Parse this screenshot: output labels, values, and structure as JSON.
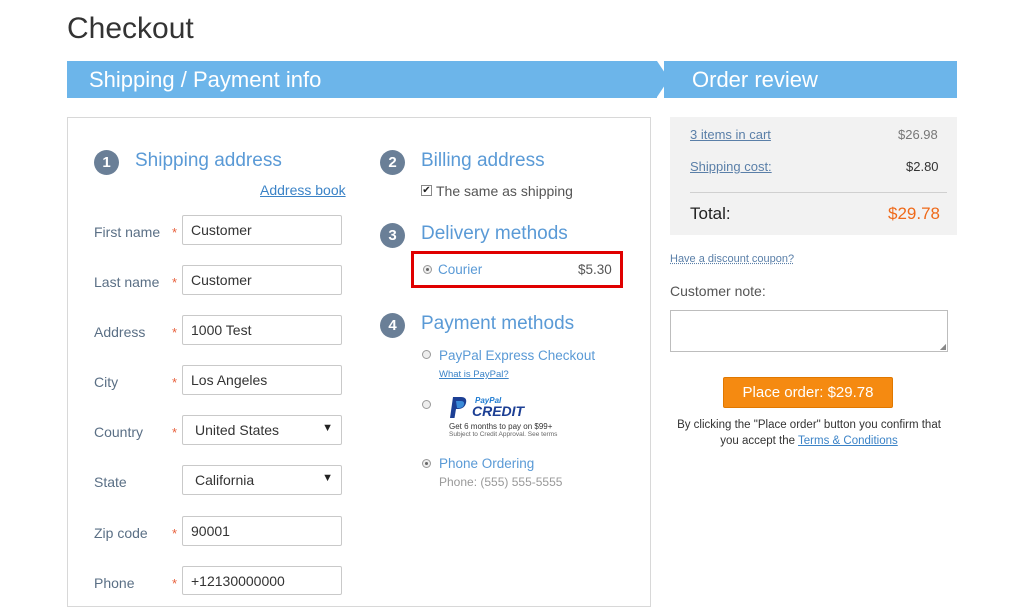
{
  "page": {
    "title": "Checkout"
  },
  "header": {
    "left_label": "Shipping / Payment info",
    "right_label": "Order review"
  },
  "shipping": {
    "step": "1",
    "title": "Shipping address",
    "address_book": "Address book",
    "fields": {
      "first_name": {
        "label": "First name",
        "value": "Customer"
      },
      "last_name": {
        "label": "Last name",
        "value": "Customer"
      },
      "address": {
        "label": "Address",
        "value": "1000 Test"
      },
      "city": {
        "label": "City",
        "value": "Los Angeles"
      },
      "country": {
        "label": "Country",
        "value": "United States"
      },
      "state": {
        "label": "State",
        "value": "California"
      },
      "zip": {
        "label": "Zip code",
        "value": "90001"
      },
      "phone": {
        "label": "Phone",
        "value": "+12130000000"
      }
    },
    "required_mark": "*"
  },
  "billing": {
    "step": "2",
    "title": "Billing address",
    "same_as_shipping": "The same as shipping",
    "checked": true
  },
  "delivery": {
    "step": "3",
    "title": "Delivery methods",
    "method": "Courier",
    "price": "$5.30",
    "highlight_color": "#e00000"
  },
  "payment": {
    "step": "4",
    "title": "Payment methods",
    "paypal_express": "PayPal Express Checkout",
    "what_is_paypal": "What is PayPal?",
    "paypal_credit_logo_top": "PayPal",
    "paypal_credit_logo": "CREDIT",
    "paypal_credit_line1": "Get 6 months to pay on $99+",
    "paypal_credit_line2": "Subject to Credit Approval. See terms",
    "phone_ordering": "Phone Ordering",
    "phone_note": "Phone: (555) 555-5555",
    "selected": "phone_ordering"
  },
  "review": {
    "items_link": "3 items in cart",
    "items_value": "$26.98",
    "shipping_link": "Shipping cost:",
    "shipping_value": "$2.80",
    "total_label": "Total:",
    "total_value": "$29.78"
  },
  "coupon_link": "Have a discount coupon?",
  "customer_note_label": "Customer note:",
  "place_order_label": "Place order: $29.78",
  "terms_text_1": "By clicking the \"Place order\" button you confirm that",
  "terms_text_2": "you accept the ",
  "terms_link": "Terms & Conditions",
  "colors": {
    "accent": "#6cb5ea",
    "button": "#f58a11",
    "total": "#ef6a1a",
    "link": "#3b83c7"
  }
}
